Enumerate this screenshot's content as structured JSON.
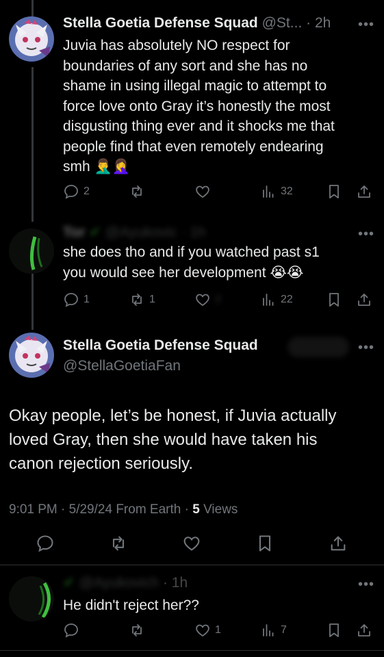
{
  "tweet1": {
    "name": "Stella Goetia Defense Squad",
    "handle": "@St...",
    "time_sep": " · ",
    "time": "2h",
    "lines": [
      "Juvia has absolutely NO respect for",
      "boundaries of any sort and she has no",
      "shame in using illegal magic to attempt to",
      "force love onto Gray it’s honestly the most",
      "disgusting thing ever and it shocks me that",
      "people find that even remotely endearing",
      "smh 🤦‍♂️🤦‍♀️"
    ],
    "replies": "2",
    "views": "32"
  },
  "tweet2": {
    "name_blurred": "Tor",
    "handle_blurred": "@Ayukovic",
    "time_blurred": "· 1h",
    "lines": [
      "she does tho and if you watched past s1",
      "you would see her development 😭😭"
    ],
    "replies": "1",
    "retweets": "1",
    "likes": "2",
    "views": "22"
  },
  "main": {
    "name": "Stella Goetia Defense Squad",
    "handle": "@StellaGoetiaFan",
    "lines": [
      "Okay people, let’s be honest, if Juvia actually",
      "loved Gray, then she would have taken his",
      "canon rejection seriously."
    ],
    "timestamp": "9:01 PM · 5/29/24 From Earth · ",
    "views_count": "5",
    "views_label": " Views"
  },
  "tweet3": {
    "handle_blurred": "@Ayukovich",
    "time": "· 1h",
    "text": "He didn't reject her??",
    "likes": "1",
    "views": "7"
  },
  "icons": {
    "more": "more-icon",
    "reply": "reply-icon",
    "retweet": "retweet-icon",
    "like": "like-icon",
    "views": "views-icon",
    "bookmark": "bookmark-icon",
    "share": "share-icon"
  },
  "colors": {
    "background": "#000000",
    "text": "#e7e9ea",
    "muted": "#71767b",
    "divider": "#2f3336"
  }
}
